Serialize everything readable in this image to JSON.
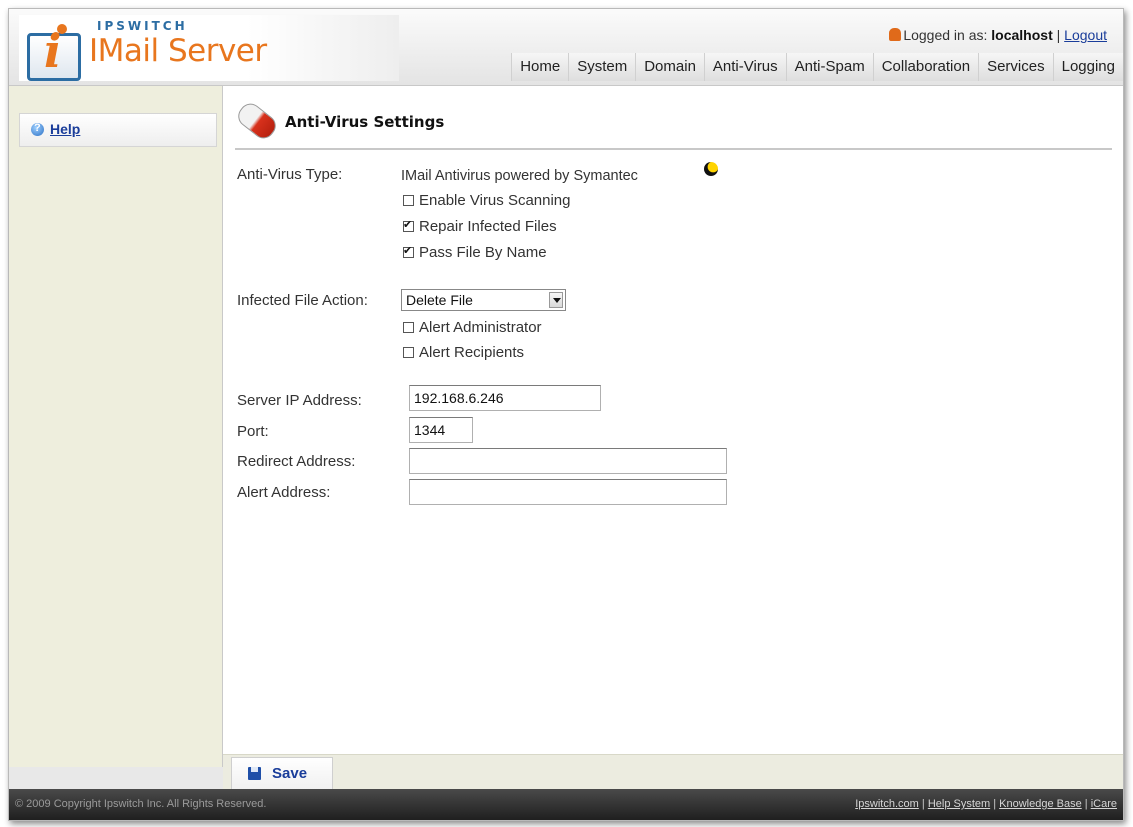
{
  "brand": {
    "company": "IPSWITCH",
    "product": "IMail Server",
    "logo_icon": "i-logo-icon"
  },
  "header": {
    "logged_in_prefix": "Logged in as:",
    "user": "localhost",
    "separator": "|",
    "logout": "Logout",
    "nav": [
      "Home",
      "System",
      "Domain",
      "Anti-Virus",
      "Anti-Spam",
      "Collaboration",
      "Services",
      "Logging"
    ]
  },
  "sidebar": {
    "help": "Help"
  },
  "page": {
    "title": "Anti-Virus Settings",
    "antivirus_type_label": "Anti-Virus Type:",
    "antivirus_type_value": "IMail Antivirus powered by Symantec",
    "options": [
      {
        "label": "Enable Virus Scanning",
        "checked": false
      },
      {
        "label": "Repair Infected Files",
        "checked": true
      },
      {
        "label": "Pass File By Name",
        "checked": true
      }
    ],
    "infected_action_label": "Infected File Action:",
    "infected_action_value": "Delete File",
    "alerts": [
      {
        "label": "Alert Administrator",
        "checked": false
      },
      {
        "label": "Alert Recipients",
        "checked": false
      }
    ],
    "server_ip_label": "Server IP Address:",
    "server_ip_value": "192.168.6.246",
    "port_label": "Port:",
    "port_value": "1344",
    "redirect_label": "Redirect Address:",
    "redirect_value": "",
    "alert_address_label": "Alert Address:",
    "alert_address_value": ""
  },
  "toolbar": {
    "save_label": "Save"
  },
  "footer": {
    "copyright": "© 2009 Copyright Ipswitch Inc. All Rights Reserved.",
    "links": [
      "Ipswitch.com",
      "Help System",
      "Knowledge Base",
      "iCare"
    ],
    "separator": "|"
  },
  "colors": {
    "brand_orange": "#e8761e",
    "brand_blue": "#2c6da3",
    "link_blue": "#1a3d9a",
    "sidebar_bg": "#eeeedd"
  }
}
